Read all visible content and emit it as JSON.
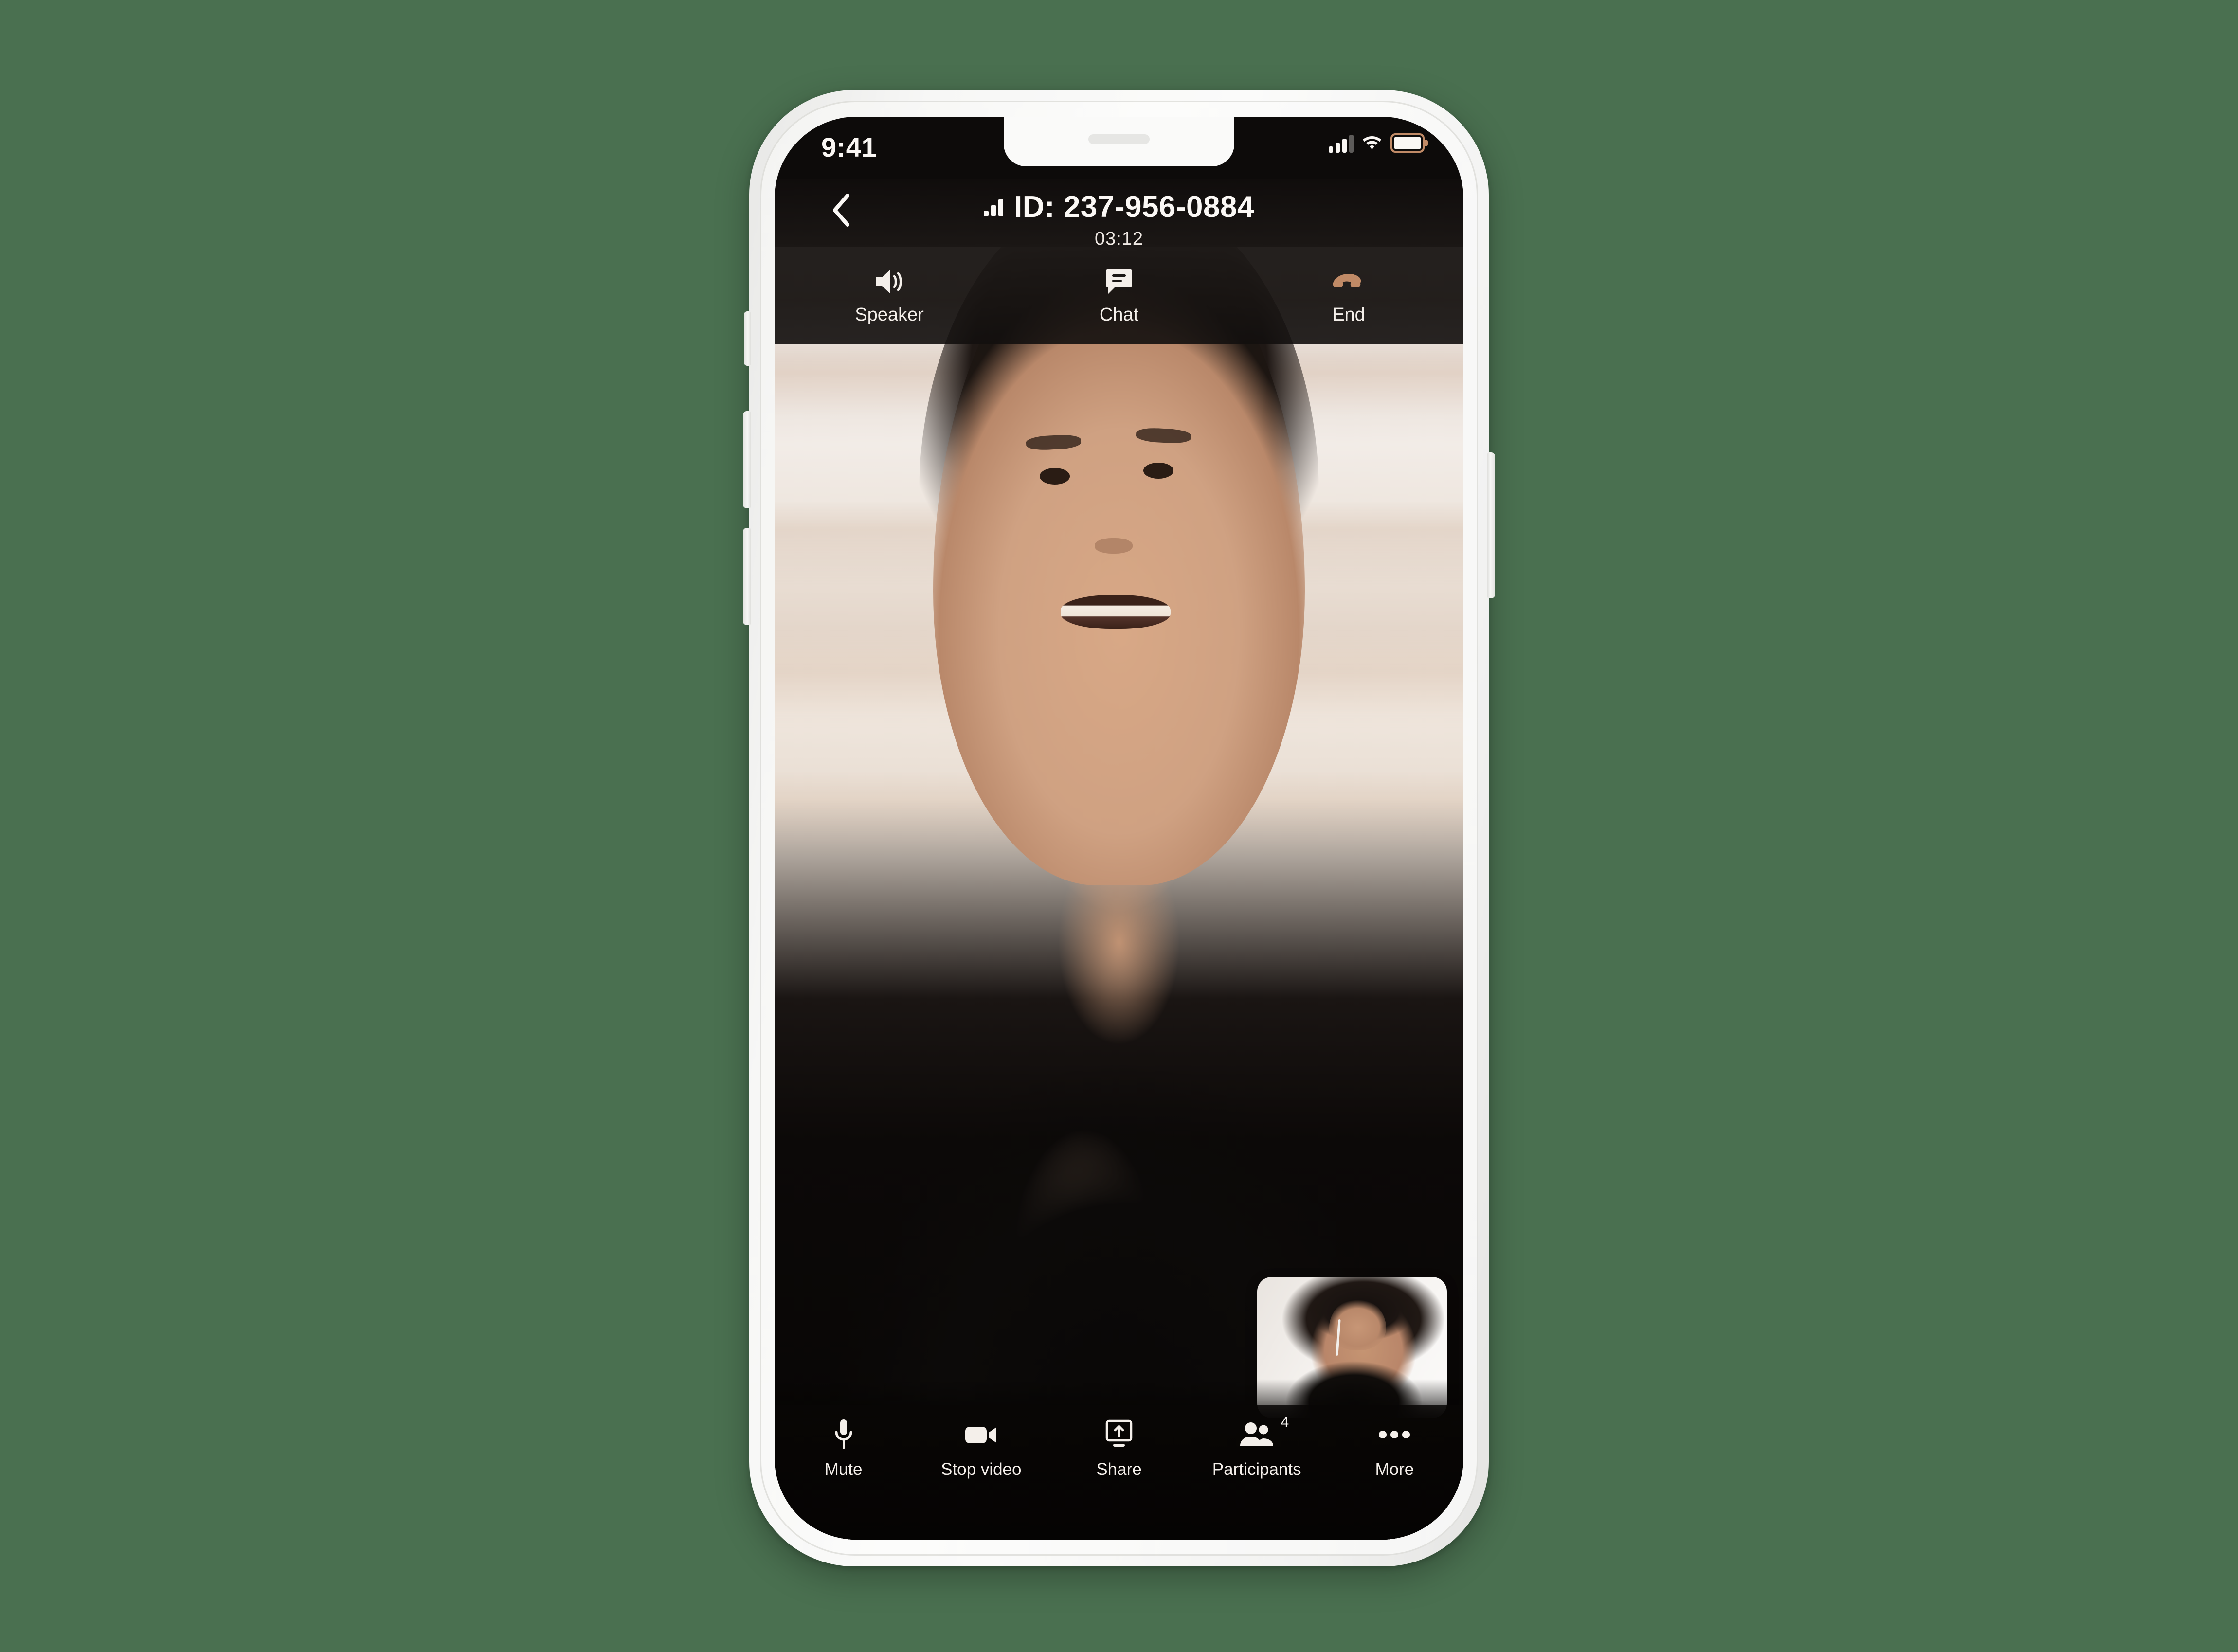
{
  "app": {
    "background_color": "#4a7050",
    "device_frame_color": "#f7f7f6",
    "screen_background": "#000000"
  },
  "status_bar": {
    "time": "9:41",
    "cellular_icon": "signal-bars-icon",
    "cellular_bars_filled": 3,
    "cellular_bars_total": 4,
    "wifi_icon": "wifi-icon",
    "battery_icon": "battery-icon",
    "battery_outline_color": "#c08a66"
  },
  "call_header": {
    "back_icon": "chevron-left-icon",
    "signal_icon": "signal-strength-icon",
    "meeting_id": "ID: 237-956-0884",
    "timer": "03:12"
  },
  "top_controls": [
    {
      "id": "speaker",
      "label": "Speaker",
      "icon": "speaker-volume-icon",
      "color": "#f4efea"
    },
    {
      "id": "chat",
      "label": "Chat",
      "icon": "chat-bubble-icon",
      "color": "#f4efea"
    },
    {
      "id": "end",
      "label": "End",
      "icon": "phone-hangup-icon",
      "color": "#c08a66"
    }
  ],
  "main_video": {
    "participant": "remote-participant-video",
    "description": "smiling person with dark hair, hands clasped"
  },
  "self_view": {
    "participant": "local-participant-video",
    "description": "person with curly hair wearing earbuds"
  },
  "bottom_toolbar": [
    {
      "id": "mute",
      "label": "Mute",
      "icon": "microphone-icon"
    },
    {
      "id": "stop-video",
      "label": "Stop video",
      "icon": "video-camera-icon"
    },
    {
      "id": "share",
      "label": "Share",
      "icon": "screen-share-icon"
    },
    {
      "id": "participants",
      "label": "Participants",
      "icon": "people-icon",
      "badge": "4"
    },
    {
      "id": "more",
      "label": "More",
      "icon": "ellipsis-icon"
    }
  ]
}
